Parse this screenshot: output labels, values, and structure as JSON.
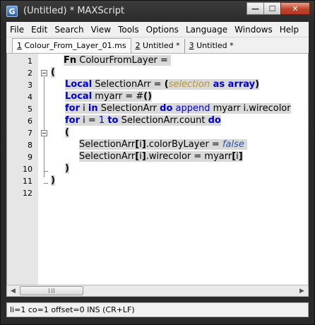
{
  "window": {
    "app_icon": "G",
    "title": "(Untitled) * MAXScript",
    "controls": {
      "minimize": "—",
      "maximize": "☐",
      "close": "✕"
    }
  },
  "menu": [
    "File",
    "Edit",
    "Search",
    "View",
    "Tools",
    "Options",
    "Language",
    "Windows",
    "Help"
  ],
  "tabs": [
    {
      "num": "1",
      "label": " Colour_From_Layer_01.ms"
    },
    {
      "num": "2",
      "label": " Untitled *"
    },
    {
      "num": "3",
      "label": " Untitled *"
    }
  ],
  "line_numbers": [
    "1",
    "2",
    "3",
    "4",
    "5",
    "6",
    "7",
    "8",
    "9",
    "10",
    "11",
    "12"
  ],
  "code": {
    "l1": [
      "Fn",
      " ColourFromLayer = "
    ],
    "l2": [
      "("
    ],
    "l3": [
      "Local",
      " SelectionArr = ",
      "(",
      "selection",
      " as ",
      "array",
      ")"
    ],
    "l4": [
      "Local",
      " myarr = #",
      "()"
    ],
    "l5": [
      "for",
      " i ",
      "in",
      " SelectionArr ",
      "do",
      " ",
      "append",
      " myarr i.wirecolor"
    ],
    "l6": [
      "for",
      " i = ",
      "1",
      " ",
      "to",
      " SelectionArr.count ",
      "do"
    ],
    "l7": [
      "("
    ],
    "l8": [
      "SelectionArr",
      "[",
      "i",
      "]",
      ".colorByLayer = ",
      "false"
    ],
    "l9": [
      "SelectionArr",
      "[",
      "i",
      "]",
      ".wirecolor = myarr",
      "[",
      "i",
      "]"
    ],
    "l10": [
      ")"
    ],
    "l11": [
      ")"
    ]
  },
  "status": "li=1 co=1 offset=0 INS (CR+LF)"
}
